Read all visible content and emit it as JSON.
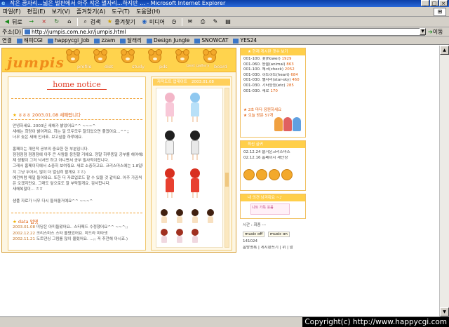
{
  "window": {
    "title": "작은 꿈자리...넓은 벌판에서 아주 작은 별자리...하지만 ... - Microsoft Internet Explorer",
    "controls": [
      "_",
      "□",
      "×"
    ]
  },
  "menu": [
    "파일(F)",
    "편집(E)",
    "보기(V)",
    "즐겨찾기(A)",
    "도구(T)",
    "도움말(H)"
  ],
  "toolbar": {
    "back": "뒤로",
    "forward": "→",
    "stop": "×",
    "refresh": "↻",
    "home": "⌂",
    "search": "검색",
    "favorites": "즐겨찾기",
    "media": "미디어",
    "history": "◷",
    "mail": "✉",
    "print": "⎙",
    "edit": "✎",
    "messenger": "▤"
  },
  "address": {
    "label": "주소(D)",
    "url": "http://jumpis.com.ne.kr/jumpis.html",
    "go": "이동"
  },
  "links": {
    "label": "연결",
    "items": [
      "해피CGI",
      "happycgi_Job",
      "zzam",
      "달래리",
      "Design Jungle",
      "SNOWCAT",
      "YES24"
    ]
  },
  "site": {
    "logo": "jumpis",
    "nav": [
      "profile",
      "diet",
      "study",
      "pds",
      "best gallery",
      "board"
    ],
    "notice_title": "home notice",
    "notice_date": "ㅎㅎㅎ  2003.01.08  새해랍니다",
    "notice_lines": [
      "안녕하세요. 2003년 새해가 밝았어요^^ ~~~^",
      "새해는 희망이 밝아져요. 하는 일 모두모두 잘되었으면 좋겠어요...^^;;",
      "너무 늦은 새해 인사죠. 보고싶을 하루에요.",
      "",
      "홈페이는 개인적 공부의 중요한 한 부분입니다.",
      "점점점점 점점점에 아주 큰 사람을 응원할 거에요. 정말 하루종일 공부를 해야해요.",
      "제 생활이 그저 낙서만 하고 아니면서 공부 필사적이랍니다.",
      "그래서 홈페이지에서 소중히 보여줘요. 새로 소중하고요. 크리스마스에는 1.8일까",
      "지 그냥 두어서, 많이 더 열심히 할게요 ㅎㅎ)",
      "예전처럼 매일 들어와요. 또한 더 자료업로드 할 수 있을 것 같아요. 아주 가끔씩은 오겠지만요. 그래도 앞으로도 잘 부탁할게요. 감사합니다.",
      "새해복많이... ㅎㅎ",
      "",
      "샘플 자료가 너무 다시 들어올거예요^^ ~~~^"
    ],
    "updates_title": "data 업뎃",
    "updates": [
      {
        "date": "2003.01.08",
        "text": "미당은 아미들왔어요.. 스타패드 수정했어요^^ ~~^;;"
      },
      {
        "date": "2002.12.22",
        "text": "크리스마스 스타 올렸었어요. 미드라 미타넷"
      },
      {
        "date": "2002.11.21",
        "text": "도트댄싱 그림를 많이 올렸어요. ...;; 꼭 추천해 아시죠.)"
      }
    ],
    "gallery_title": "자작도트 업데이트",
    "gallery_date": "2003.01.08",
    "sidebar": {
      "box1_title": "★ 현재 게시판 갯수 보기",
      "box1_rows": [
        {
          "label": "001-100. 꽃(flower)",
          "count": "1929"
        },
        {
          "label": "001-060. 동물(animal)",
          "count": "863"
        },
        {
          "label": "001-100. 체크(check)",
          "count": "2052"
        },
        {
          "label": "001-030. 하트하트(heart)",
          "count": "684"
        },
        {
          "label": "001-030. 별자리(star-sky)",
          "count": "460"
        },
        {
          "label": "001-030. 기타등등(etc)",
          "count": "285"
        },
        {
          "label": "001-030. 새로",
          "count": "170"
        }
      ],
      "box1_total_label": "오늘 방문",
      "box1_total_value": "57개",
      "box1_today": "2초 마다 응원하세요",
      "box2_title": "최신 글귀",
      "box2_rows": [
        {
          "date": "02.12.24",
          "text": "즐거운크리스마스"
        },
        {
          "date": "02.12.16",
          "text": "홈페이지 새단장"
        }
      ],
      "box3_title": "내 의견 남겨줘요 ~♪",
      "box3_text": "니트 가득 웃음",
      "box4_title": "시간 : 최종 ---",
      "box4_buttons": [
        "music off",
        "music on"
      ],
      "box4_counter": "141024",
      "box4_links": [
        "홈방명록",
        "게시판쓰기",
        "위",
        "앞"
      ]
    }
  },
  "footer": {
    "copyright": "Copyright(c) http://www.happycgi.com"
  },
  "colors": {
    "accent": "#ffcf4a",
    "brand": "#f08c1a",
    "title_red": "#e0402a",
    "text_orange": "#e06010"
  }
}
